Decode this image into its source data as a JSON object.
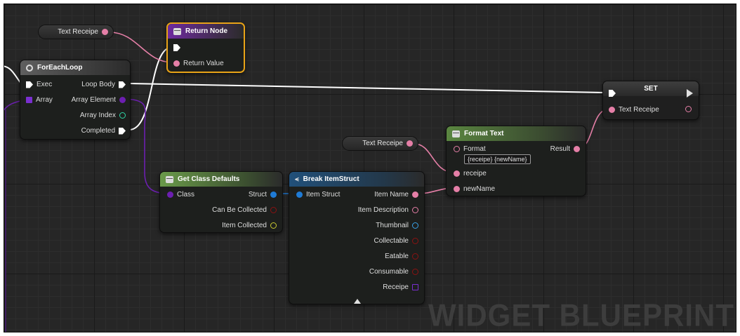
{
  "watermark": "WIDGET BLUEPRINT",
  "colors": {
    "exec": "#ffffff",
    "text_pin": "#e57fa7",
    "struct_pin": "#1f7bd6",
    "class_pin": "#6c1fb0",
    "int_pin": "#2fd6a6",
    "bool_pin": "#8c1212",
    "object_pin": "#c8c832",
    "texture_pin": "#3aa0e6",
    "array_pin": "#7a2fd0",
    "selection": "#e8a317"
  },
  "nodes": {
    "text_receipe_top": {
      "label": "Text Receipe",
      "pin_icon": "text-pin"
    },
    "text_receipe_mid": {
      "label": "Text Receipe",
      "pin_icon": "text-pin"
    },
    "return_node": {
      "title": "Return Node",
      "pins": {
        "return_value": "Return Value"
      }
    },
    "for_each_loop": {
      "title": "ForEachLoop",
      "pins": {
        "exec": "Exec",
        "array": "Array",
        "loop_body": "Loop Body",
        "array_element": "Array Element",
        "array_index": "Array Index",
        "completed": "Completed"
      }
    },
    "set_node": {
      "title": "SET",
      "pins": {
        "text_receipe": "Text Receipe"
      }
    },
    "format_text": {
      "title": "Format Text",
      "pins": {
        "format": "Format",
        "format_value": "{receipe} {newName}",
        "result": "Result",
        "receipe": "receipe",
        "new_name": "newName"
      }
    },
    "get_class_defaults": {
      "title": "Get Class Defaults",
      "pins": {
        "class": "Class",
        "struct": "Struct",
        "can_be_collected": "Can Be Collected",
        "item_collected": "Item Collected"
      }
    },
    "break_item_struct": {
      "title": "Break ItemStruct",
      "pins": {
        "item_struct": "Item Struct",
        "item_name": "Item Name",
        "item_description": "Item Description",
        "thumbnail": "Thumbnail",
        "collectable": "Collectable",
        "eatable": "Eatable",
        "consumable": "Consumable",
        "receipe": "Receipe"
      }
    }
  }
}
